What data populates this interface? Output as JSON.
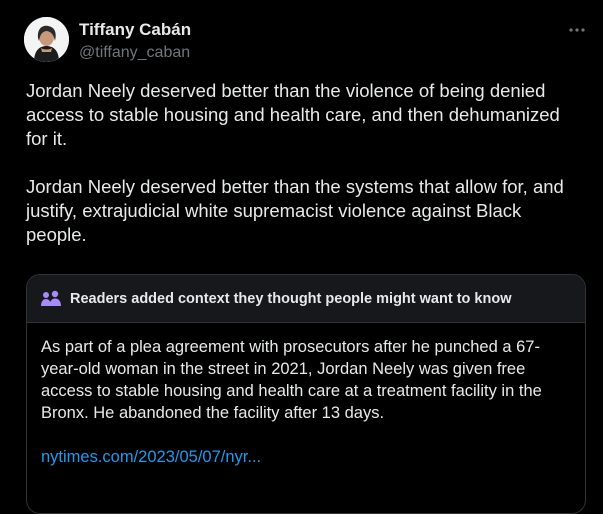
{
  "author": {
    "display_name": "Tiffany Cabán",
    "handle": "@tiffany_caban"
  },
  "tweet": {
    "paragraphs": [
      "Jordan Neely deserved better than the violence of being denied access to stable housing and health care, and then dehumanized for it.",
      "Jordan Neely deserved better than the systems that allow for, and justify, extrajudicial white supremacist violence against Black people."
    ]
  },
  "community_note": {
    "title": "Readers added context they thought people might want to know",
    "body": "As part of a plea agreement with prosecutors after he punched a  67-year-old woman in the street in 2021, Jordan Neely was given free access to stable housing and health care at a treatment facility in the Bronx. He abandoned the facility after 13 days.",
    "link_text": "nytimes.com/2023/05/07/nyr..."
  },
  "icons": {
    "more": "more-horizontal-icon",
    "notes": "people-icon"
  },
  "colors": {
    "background": "#000000",
    "text_primary": "#e7e9ea",
    "text_secondary": "#71767b",
    "border": "#2f3336",
    "note_header_bg": "#16181c",
    "link": "#1d9bf0",
    "notes_icon": "#a78bfa"
  }
}
